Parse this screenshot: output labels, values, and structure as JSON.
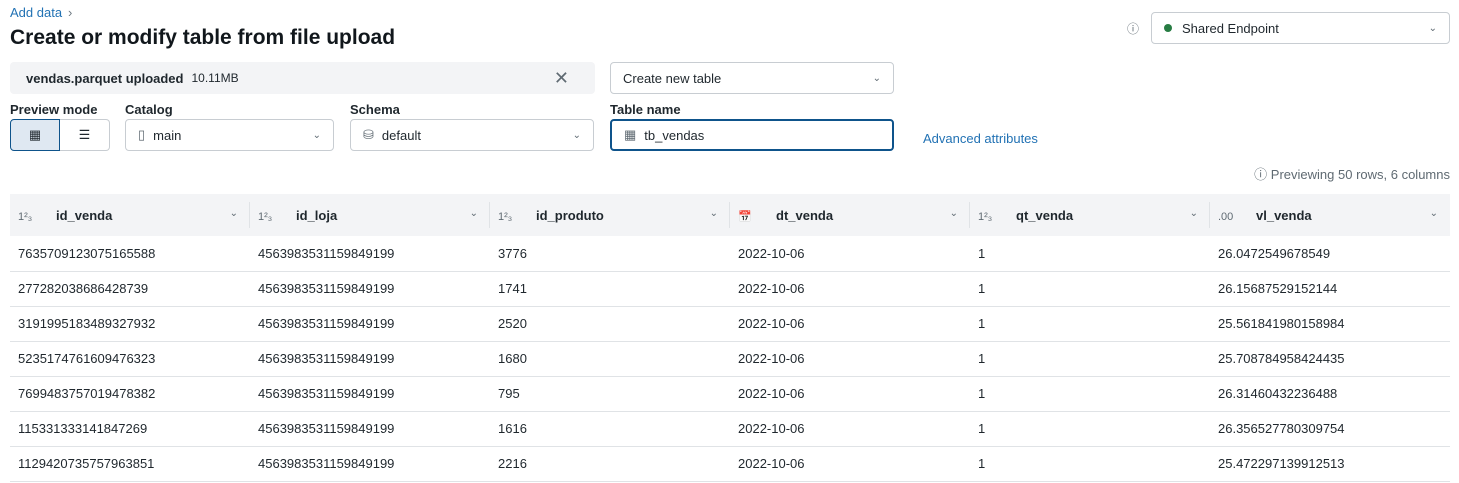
{
  "breadcrumb": {
    "link": "Add data",
    "sep": "›"
  },
  "title": "Create or modify table from file upload",
  "endpoint": {
    "label": "Shared Endpoint",
    "status_color": "#277c43"
  },
  "upload": {
    "filename": "vendas.parquet uploaded",
    "size": "10.11MB"
  },
  "mode_select": "Create new table",
  "preview_mode_label": "Preview mode",
  "catalog": {
    "label": "Catalog",
    "value": "main"
  },
  "schema": {
    "label": "Schema",
    "value": "default"
  },
  "table_name": {
    "label": "Table name",
    "value": "tb_vendas"
  },
  "advanced": "Advanced attributes",
  "preview_info": "Previewing 50 rows, 6 columns",
  "columns": [
    {
      "name": "id_venda",
      "type": "1²₃"
    },
    {
      "name": "id_loja",
      "type": "1²₃"
    },
    {
      "name": "id_produto",
      "type": "1²₃"
    },
    {
      "name": "dt_venda",
      "type": "📅"
    },
    {
      "name": "qt_venda",
      "type": "1²₃"
    },
    {
      "name": "vl_venda",
      "type": ".00"
    }
  ],
  "rows": [
    [
      "7635709123075165588",
      "4563983531159849199",
      "3776",
      "2022-10-06",
      "1",
      "26.0472549678549"
    ],
    [
      "277282038686428739",
      "4563983531159849199",
      "1741",
      "2022-10-06",
      "1",
      "26.15687529152144"
    ],
    [
      "3191995183489327932",
      "4563983531159849199",
      "2520",
      "2022-10-06",
      "1",
      "25.561841980158984"
    ],
    [
      "5235174761609476323",
      "4563983531159849199",
      "1680",
      "2022-10-06",
      "1",
      "25.708784958424435"
    ],
    [
      "7699483757019478382",
      "4563983531159849199",
      "795",
      "2022-10-06",
      "1",
      "26.31460432236488"
    ],
    [
      "115331333141847269",
      "4563983531159849199",
      "1616",
      "2022-10-06",
      "1",
      "26.356527780309754"
    ],
    [
      "1129420735757963851",
      "4563983531159849199",
      "2216",
      "2022-10-06",
      "1",
      "25.472297139912513"
    ]
  ]
}
